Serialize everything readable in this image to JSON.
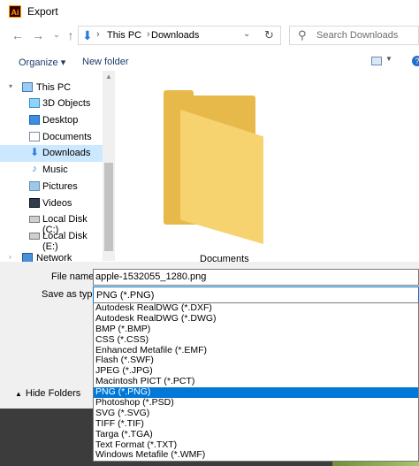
{
  "window": {
    "app_icon_text": "Ai",
    "title": "Export"
  },
  "nav": {
    "back_icon": "←",
    "forward_icon": "→",
    "recent_icon": "⌄",
    "up_icon": "↑",
    "path": [
      "This PC",
      "Downloads"
    ],
    "separator": "›",
    "chevron": "⌄",
    "refresh_icon": "↻"
  },
  "search": {
    "icon": "⚲",
    "placeholder": "Search Downloads"
  },
  "toolbar": {
    "organize": "Organize ▾",
    "new_folder": "New folder",
    "help": "?"
  },
  "sidebar": {
    "items": [
      {
        "label": "This PC",
        "icon": "computer-icon"
      },
      {
        "label": "3D Objects",
        "icon": "cube-icon"
      },
      {
        "label": "Desktop",
        "icon": "desktop-icon"
      },
      {
        "label": "Documents",
        "icon": "document-icon"
      },
      {
        "label": "Downloads",
        "icon": "download-icon",
        "selected": true
      },
      {
        "label": "Music",
        "icon": "music-icon"
      },
      {
        "label": "Pictures",
        "icon": "pictures-icon"
      },
      {
        "label": "Videos",
        "icon": "video-icon"
      },
      {
        "label": "Local Disk (C:)",
        "icon": "disk-icon"
      },
      {
        "label": "Local Disk (E:)",
        "icon": "disk-icon"
      },
      {
        "label": "Network",
        "icon": "network-icon"
      }
    ]
  },
  "content": {
    "items": [
      {
        "label": "Documents",
        "icon": "folder-icon"
      }
    ]
  },
  "form": {
    "file_name_label": "File name:",
    "file_name_value": "apple-1532055_1280.png",
    "save_as_type_label": "Save as type:",
    "save_as_type_value": "PNG (*.PNG)",
    "hide_folders": "Hide Folders"
  },
  "file_types": [
    "Autodesk RealDWG (*.DXF)",
    "Autodesk RealDWG (*.DWG)",
    "BMP (*.BMP)",
    "CSS (*.CSS)",
    "Enhanced Metafile (*.EMF)",
    "Flash (*.SWF)",
    "JPEG (*.JPG)",
    "Macintosh PICT (*.PCT)",
    "PNG (*.PNG)",
    "Photoshop (*.PSD)",
    "SVG (*.SVG)",
    "TIFF (*.TIF)",
    "Targa (*.TGA)",
    "Text Format (*.TXT)",
    "Windows Metafile (*.WMF)"
  ],
  "selected_file_type": "PNG (*.PNG)",
  "colors": {
    "accent": "#0078d7",
    "selection_bg": "#cce8ff",
    "folder": "#f6d36f"
  }
}
